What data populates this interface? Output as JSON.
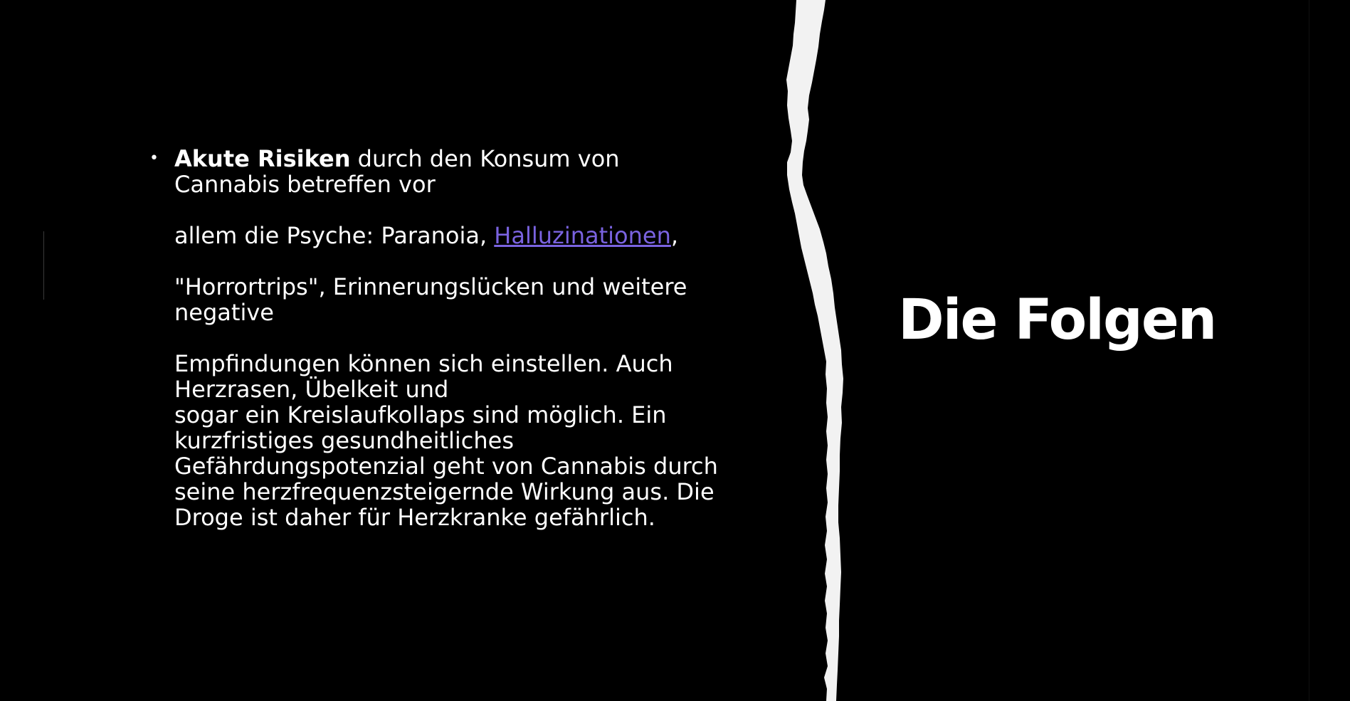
{
  "slide": {
    "title": "Die Folgen",
    "bullet_symbol": "•",
    "body": {
      "lead_bold": "Akute Risiken",
      "line1_rest": " durch den Konsum von",
      "line2": "Cannabis betreffen vor",
      "line3_pre": "allem die Psyche: Paranoia, ",
      "link_text": "Halluzinationen",
      "line3_post": ",",
      "line4": "\"Horrortrips\", Erinnerungslücken und weitere",
      "line5": "negative",
      "line6": "Empfindungen können sich einstellen. Auch",
      "line7": "Herzrasen, Übelkeit und",
      "line8": "sogar ein Kreislaufkollaps sind möglich. Ein",
      "line9": "kurzfristiges gesundheitliches",
      "line10": "Gefährdungspotenzial geht von Cannabis durch",
      "line11": "seine herzfrequenzsteigernde Wirkung aus. Die",
      "line12": "Droge ist daher für Herzkranke gefährlich."
    },
    "colors": {
      "background": "#000000",
      "text": "#ffffff",
      "link": "#7a63e0",
      "tear": "#f2f2f2"
    }
  }
}
